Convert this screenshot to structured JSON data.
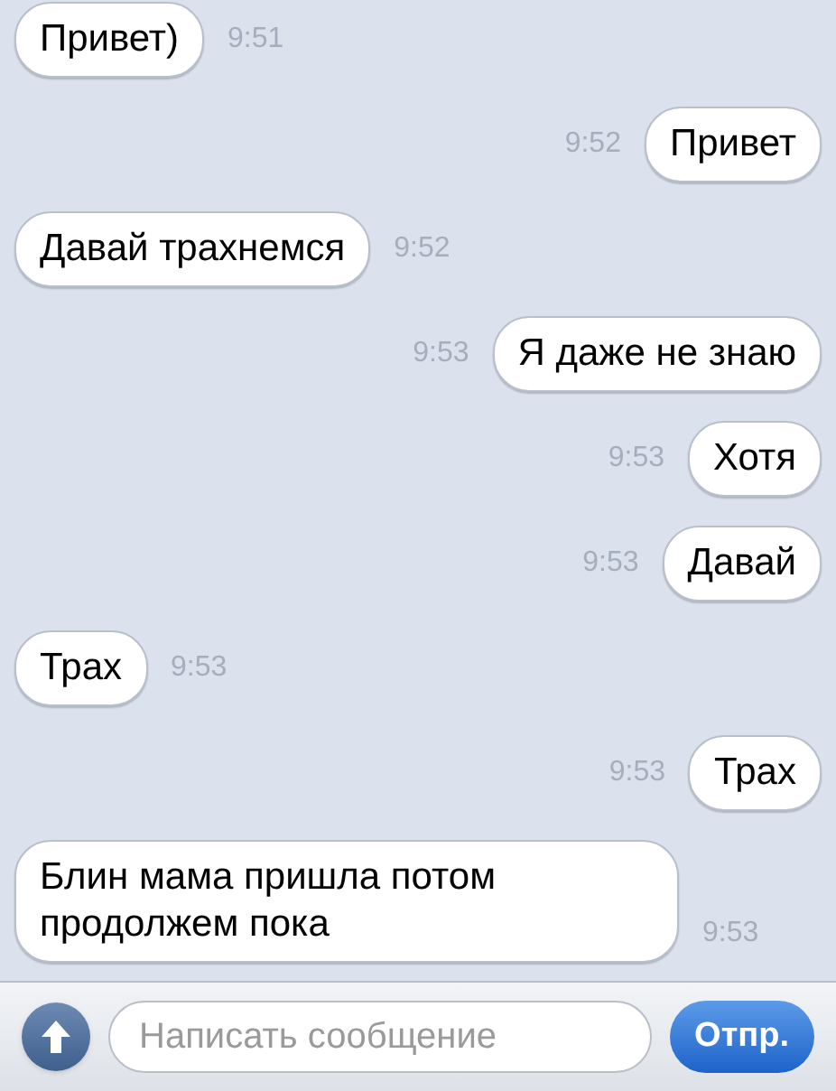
{
  "messages": [
    {
      "kind": "incoming",
      "text": "Привет)",
      "time": "9:51"
    },
    {
      "kind": "outgoing",
      "text": "Привет",
      "time": "9:52"
    },
    {
      "kind": "incoming",
      "text": "Давай трахнемся",
      "time": "9:52"
    },
    {
      "kind": "outgoing",
      "text": "Я даже не знаю",
      "time": "9:53"
    },
    {
      "kind": "outgoing",
      "text": "Хотя",
      "time": "9:53"
    },
    {
      "kind": "outgoing",
      "text": "Давай",
      "time": "9:53"
    },
    {
      "kind": "incoming",
      "text": "Трах",
      "time": "9:53"
    },
    {
      "kind": "outgoing",
      "text": "Трах",
      "time": "9:53"
    },
    {
      "kind": "incoming",
      "text": "Блин мама пришла потом продолжем пока",
      "time": "9:53"
    }
  ],
  "composer": {
    "placeholder": "Написать сообщение",
    "send": "Отпр."
  }
}
